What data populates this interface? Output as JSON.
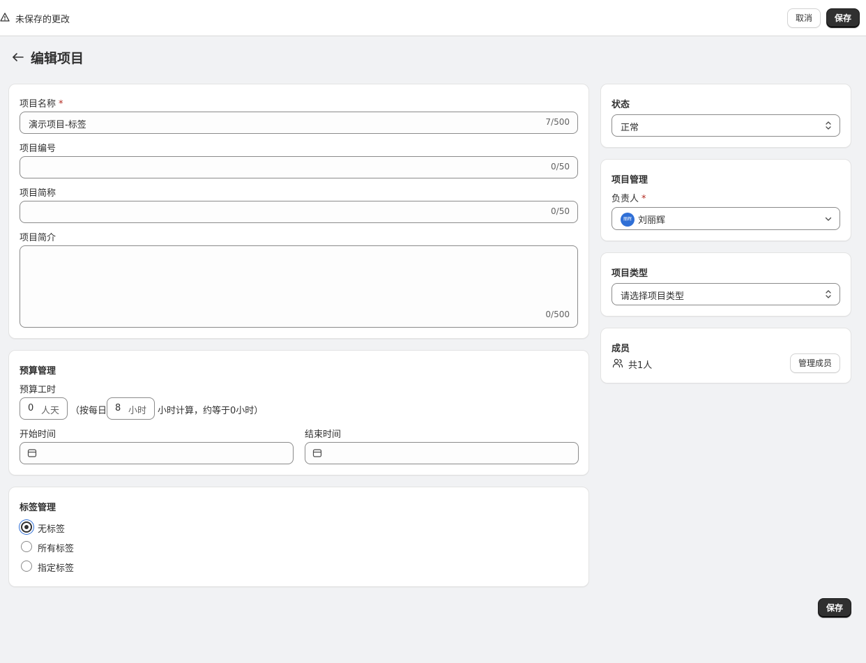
{
  "topbar": {
    "unsaved_text": "未保存的更改",
    "cancel_label": "取消",
    "save_label": "保存"
  },
  "page": {
    "title": "编辑项目"
  },
  "basic": {
    "name_label": "项目名称",
    "required_mark": "*",
    "name_value": "演示项目-标签",
    "name_count": "7/500",
    "code_label": "项目编号",
    "code_value": "",
    "code_count": "0/50",
    "short_label": "项目简称",
    "short_value": "",
    "short_count": "0/50",
    "desc_label": "项目简介",
    "desc_value": "",
    "desc_count": "0/500"
  },
  "budget": {
    "title": "预算管理",
    "hours_label": "预算工时",
    "days_value": "0",
    "days_unit": "人天",
    "per_day_prefix": "（按每日",
    "hours_per_day_value": "8",
    "hours_per_day_unit": "小时",
    "calc_suffix": "小时计算，约等于0小时）",
    "start_label": "开始时间",
    "end_label": "结束时间"
  },
  "tags": {
    "title": "标签管理",
    "options": [
      {
        "label": "无标签",
        "selected": true
      },
      {
        "label": "所有标签",
        "selected": false
      },
      {
        "label": "指定标签",
        "selected": false
      }
    ]
  },
  "status": {
    "title": "状态",
    "value": "正常"
  },
  "management": {
    "title": "项目管理",
    "owner_label": "负责人",
    "required_mark": "*",
    "owner_avatar_text": "丽辉",
    "owner_name": "刘丽辉"
  },
  "project_type": {
    "title": "项目类型",
    "placeholder": "请选择项目类型"
  },
  "members": {
    "title": "成员",
    "count_text": "共1人",
    "manage_label": "管理成员"
  },
  "footer": {
    "save_label": "保存"
  },
  "colors": {
    "accent": "#303030",
    "focus_ring": "#2f6fd6",
    "required": "#b22a20",
    "background": "#f1f2f4"
  }
}
